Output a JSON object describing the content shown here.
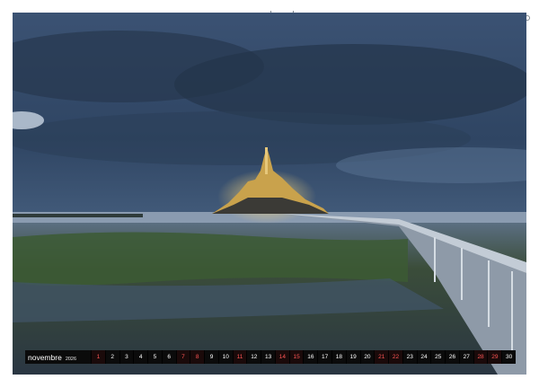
{
  "calendar": {
    "month": "novembre",
    "year": "2026",
    "days": [
      {
        "n": "1",
        "red": true
      },
      {
        "n": "2",
        "red": false
      },
      {
        "n": "3",
        "red": false
      },
      {
        "n": "4",
        "red": false
      },
      {
        "n": "5",
        "red": false
      },
      {
        "n": "6",
        "red": false
      },
      {
        "n": "7",
        "red": true
      },
      {
        "n": "8",
        "red": true
      },
      {
        "n": "9",
        "red": false
      },
      {
        "n": "10",
        "red": false
      },
      {
        "n": "11",
        "red": true
      },
      {
        "n": "12",
        "red": false
      },
      {
        "n": "13",
        "red": false
      },
      {
        "n": "14",
        "red": true
      },
      {
        "n": "15",
        "red": true
      },
      {
        "n": "16",
        "red": false
      },
      {
        "n": "17",
        "red": false
      },
      {
        "n": "18",
        "red": false
      },
      {
        "n": "19",
        "red": false
      },
      {
        "n": "20",
        "red": false
      },
      {
        "n": "21",
        "red": true
      },
      {
        "n": "22",
        "red": true
      },
      {
        "n": "23",
        "red": false
      },
      {
        "n": "24",
        "red": false
      },
      {
        "n": "25",
        "red": false
      },
      {
        "n": "26",
        "red": false
      },
      {
        "n": "27",
        "red": false
      },
      {
        "n": "28",
        "red": true
      },
      {
        "n": "29",
        "red": true
      },
      {
        "n": "30",
        "red": false
      }
    ]
  },
  "colors": {
    "weekend": "#ff5555",
    "bar": "#0b0b0b"
  }
}
